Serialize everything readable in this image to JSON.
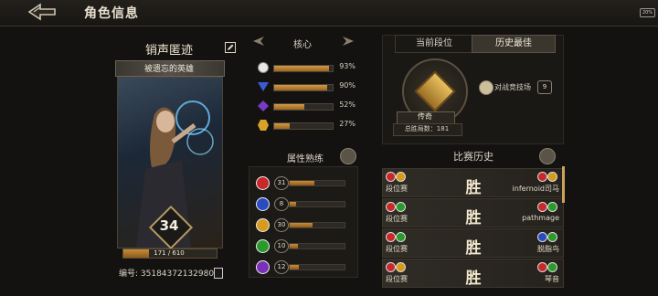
{
  "header": {
    "title": "角色信息",
    "battery": "20%"
  },
  "hero": {
    "name": "销声匿迹",
    "title": "被遗忘的英雄",
    "level": "34",
    "xp_text": "171 / 610",
    "xp_fraction": 0.28,
    "serial": "编号: 35184372132980"
  },
  "core": {
    "title": "核心",
    "items": [
      {
        "icon": "white-orb-icon",
        "color": "#e8e8e8",
        "percent": 93,
        "label": "93%"
      },
      {
        "icon": "blue-triangle-icon",
        "color": "#3a5ad8",
        "percent": 90,
        "label": "90%"
      },
      {
        "icon": "purple-gem-icon",
        "color": "#7a3ac8",
        "percent": 52,
        "label": "52%"
      },
      {
        "icon": "gold-hexagon-icon",
        "color": "#d8a22a",
        "percent": 27,
        "label": "27%"
      }
    ]
  },
  "attributes": {
    "title": "属性熟练",
    "items": [
      {
        "icon": "red-attribute-icon",
        "color": "#c82828",
        "value": "31",
        "fraction": 0.45
      },
      {
        "icon": "blue-attribute-icon",
        "color": "#2a4ac0",
        "value": "8",
        "fraction": 0.12
      },
      {
        "icon": "gold-attribute-icon",
        "color": "#d89a1a",
        "value": "30",
        "fraction": 0.42
      },
      {
        "icon": "green-attribute-icon",
        "color": "#2a9a2a",
        "value": "10",
        "fraction": 0.15
      },
      {
        "icon": "purple-attribute-icon",
        "color": "#7a30b8",
        "value": "12",
        "fraction": 0.17
      }
    ]
  },
  "rank": {
    "tabs": [
      "当前段位",
      "历史最佳"
    ],
    "rank_name": "传奇",
    "total_wins": "总胜局数：181",
    "arena_label": "对战竞技场",
    "arena_count": "9"
  },
  "history": {
    "title": "比赛历史",
    "matches": [
      {
        "mode": "段位赛",
        "result": "胜",
        "opponent": "infernoid司马",
        "my_colors": [
          "#c82828",
          "#d89a1a"
        ],
        "opp_colors": [
          "#c82828",
          "#d89a1a"
        ]
      },
      {
        "mode": "段位赛",
        "result": "胜",
        "opponent": "pathmage",
        "my_colors": [
          "#c82828",
          "#2a9a2a"
        ],
        "opp_colors": [
          "#c82828",
          "#2a9a2a"
        ]
      },
      {
        "mode": "段位赛",
        "result": "胜",
        "opponent": "脱脂鸟",
        "my_colors": [
          "#c82828",
          "#2a9a2a"
        ],
        "opp_colors": [
          "#2a4ac0",
          "#2a9a2a"
        ]
      },
      {
        "mode": "段位赛",
        "result": "胜",
        "opponent": "琴音",
        "my_colors": [
          "#c82828",
          "#d89a1a"
        ],
        "opp_colors": [
          "#c82828",
          "#2a9a2a"
        ]
      }
    ]
  }
}
